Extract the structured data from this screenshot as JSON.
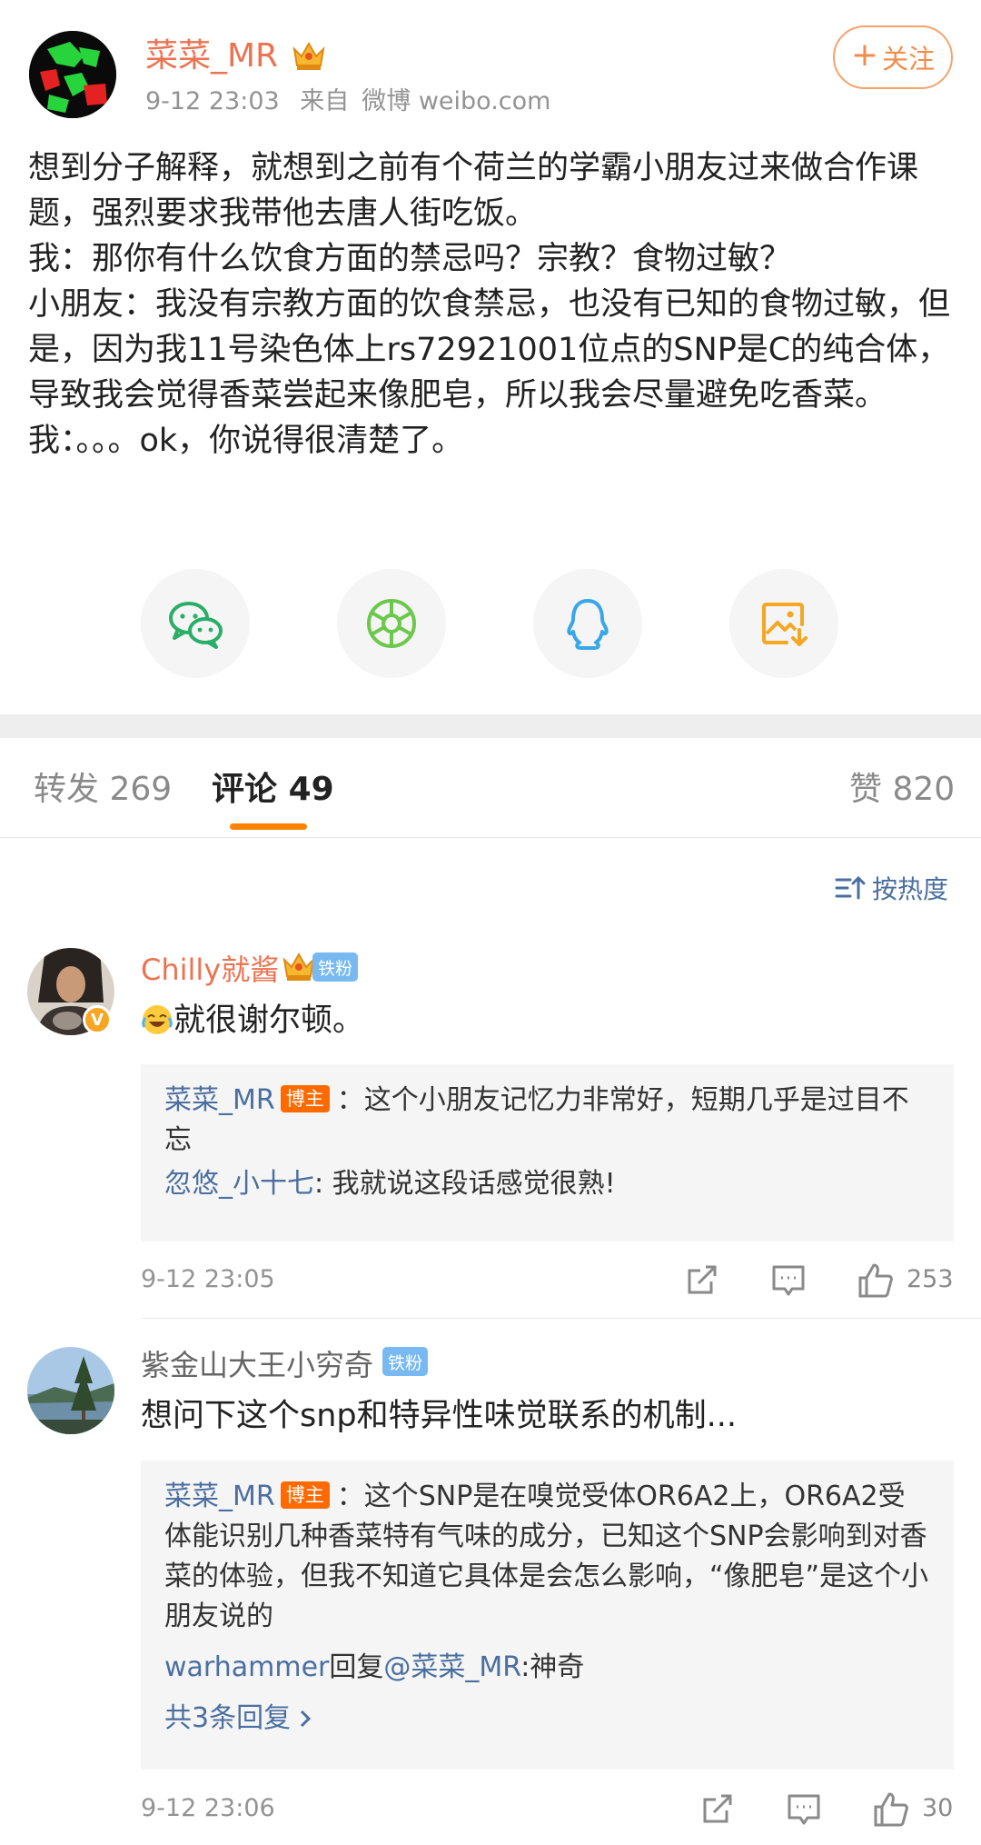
{
  "post": {
    "author": "菜菜_MR",
    "time": "9-12 23:03",
    "source_prefix": "来自",
    "source": "微博 weibo.com",
    "follow_label": "关注",
    "body_lines": [
      "想到分子解释，就想到之前有个荷兰的学霸小朋友过来做合作课题，强烈要求我带他去唐人街吃饭。",
      "我：那你有什么饮食方面的禁忌吗？宗教？食物过敏？",
      "小朋友：我没有宗教方面的饮食禁忌，也没有已知的食物过敏，但是，因为我11号染色体上rs72921001位点的SNP是C的纯合体，导致我会觉得香菜尝起来像肥皂，所以我会尽量避免吃香菜。",
      "我：。。。ok，你说得很清楚了。"
    ]
  },
  "share": {
    "items": [
      "wechat-icon",
      "moments-icon",
      "qq-icon",
      "save-image-icon"
    ]
  },
  "tabs": {
    "repost_label": "转发",
    "repost_count": "269",
    "comment_label": "评论",
    "comment_count": "49",
    "like_label": "赞",
    "like_count": "820"
  },
  "sort": {
    "label": "按热度"
  },
  "comments": [
    {
      "name": "Chilly就酱",
      "fan_badge": "铁粉",
      "text": "就很谢尔顿。",
      "emoji": "laugh-cry-emoji",
      "replies": [
        {
          "user": "菜菜_MR",
          "tag": "博主",
          "text": "：这个小朋友记忆力非常好，短期几乎是过目不忘"
        },
        {
          "user": "忽悠_小十七",
          "text": ": 我就说这段话感觉很熟!"
        }
      ],
      "time": "9-12 23:05",
      "likes": "253"
    },
    {
      "name": "紫金山大王小穷奇",
      "fan_badge": "铁粉",
      "text": "想问下这个snp和特异性味觉联系的机制...",
      "replies": [
        {
          "user": "菜菜_MR",
          "tag": "博主",
          "text": "：这个SNP是在嗅觉受体OR6A2上，OR6A2受体能识别几种香菜特有气味的成分，已知这个SNP会影响到对香菜的体验，但我不知道它具体是会怎么影响，“像肥皂”是这个小朋友说的"
        },
        {
          "user": "warhammer",
          "reply_word": "回复",
          "mention": "@菜菜_MR",
          "text": ":神奇"
        }
      ],
      "more_replies": "共3条回复",
      "time": "9-12 23:06",
      "likes": "30"
    }
  ],
  "colors": {
    "accent_orange": "#ff8200",
    "author_orange": "#eb7350",
    "link_blue": "#4a6fa0",
    "host_tag": "#ff6a00",
    "fan_badge": "#77b9f0",
    "wechat_green": "#2aae67",
    "moments_green": "#6cc84b",
    "qq_blue": "#3aa6e8",
    "save_orange": "#f5a623"
  }
}
